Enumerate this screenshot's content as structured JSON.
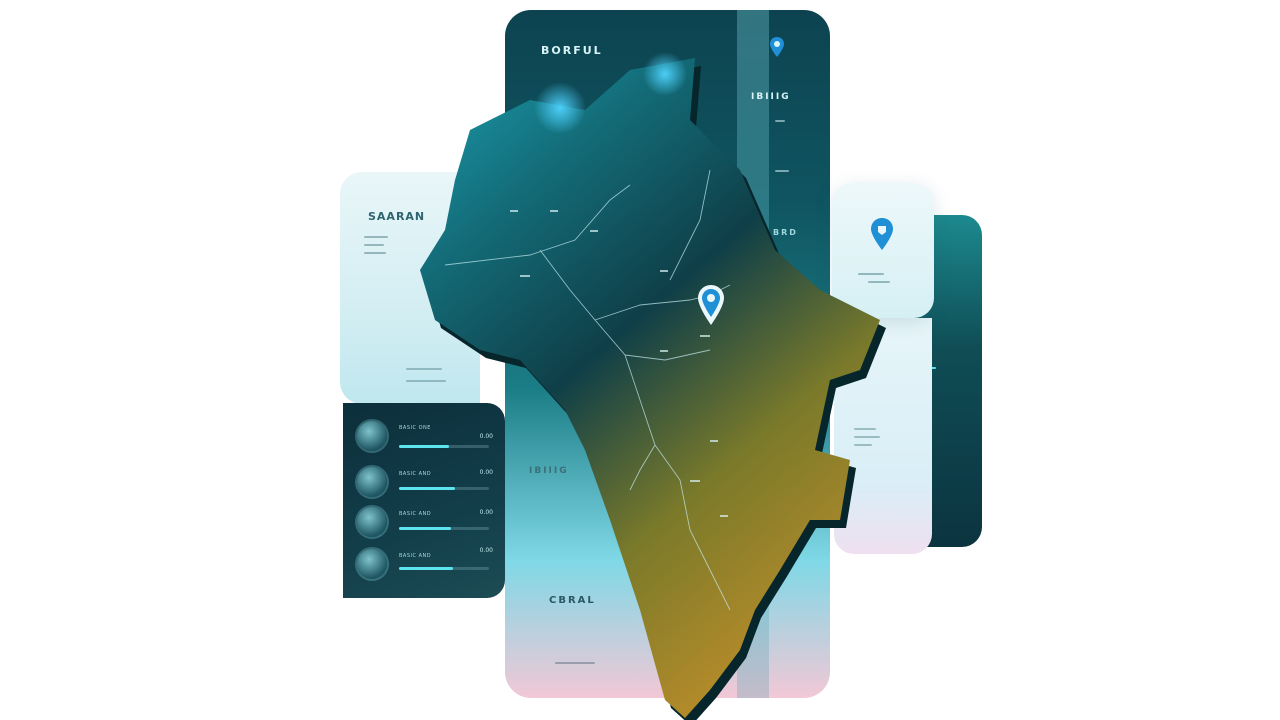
{
  "main_panel": {
    "title": "BORFUL",
    "side_label": "IBIIIG",
    "region_label": "IBIIIG",
    "bottom_label": "CBRAL",
    "map_label": "BRD"
  },
  "left_panel": {
    "title": "SAARAN"
  },
  "stats_card": {
    "rows": [
      {
        "label": "BASIC ONE",
        "value": "0.00",
        "progress": 0.55
      },
      {
        "label": "BASIC AND",
        "value": "0.00",
        "progress": 0.62
      },
      {
        "label": "BASIC AND",
        "value": "0.00",
        "progress": 0.58
      },
      {
        "label": "BASIC AND",
        "value": "0.00",
        "progress": 0.6
      }
    ]
  },
  "colors": {
    "accent": "#5ee4ee",
    "pin": "#1f8fd6",
    "terrain_dark": "#0f3b45",
    "terrain_gold": "#b0892a"
  },
  "icons": {
    "pin": "location-pin-icon",
    "avatar": "avatar"
  }
}
